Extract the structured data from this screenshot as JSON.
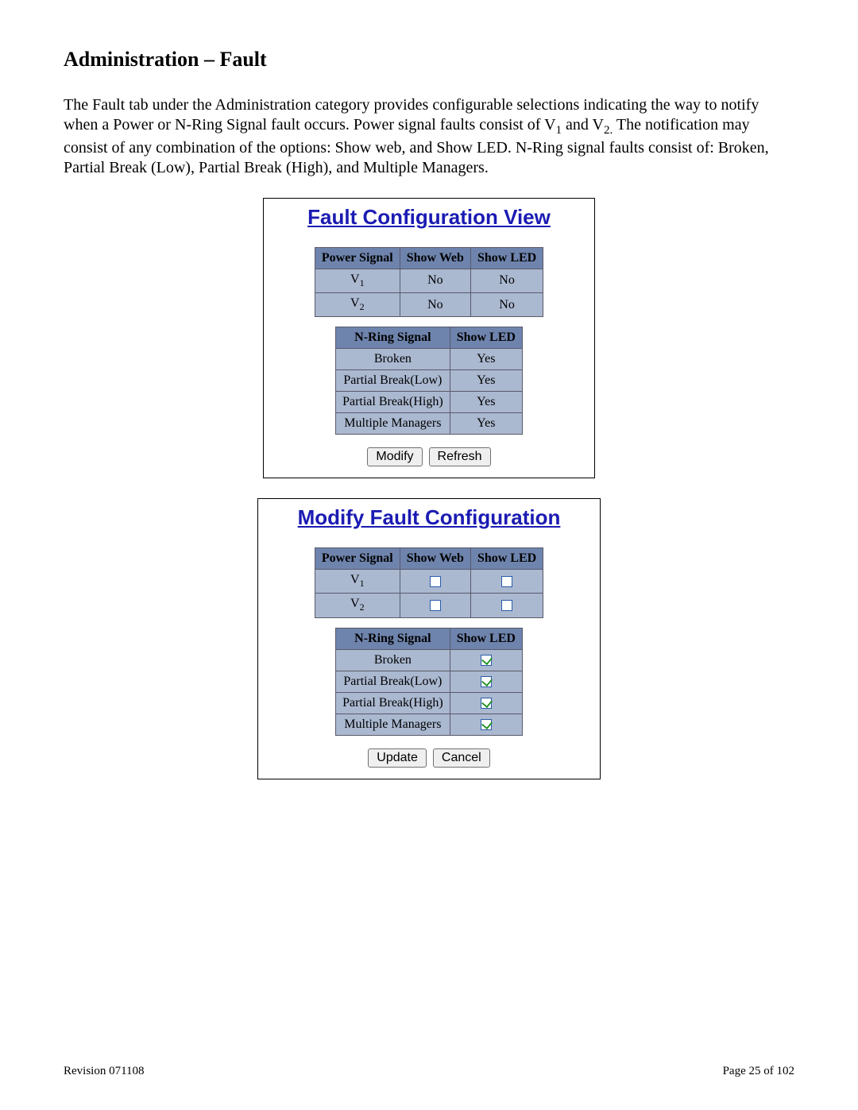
{
  "heading": "Administration – Fault",
  "intro_parts": {
    "p1": "The Fault tab under the Administration category provides configurable selections indicating the way to notify when a Power or N-Ring Signal fault occurs. Power signal faults consist of V",
    "s1": "1",
    "p2": " and V",
    "s2": "2.",
    "p3": "  The notification may consist of any combination of the options: Show web, and Show LED. N-Ring signal faults consist of: Broken, Partial Break (Low), Partial Break (High), and Multiple Managers."
  },
  "view_panel": {
    "title": "Fault Configuration View",
    "power_table": {
      "headers": [
        "Power Signal",
        "Show Web",
        "Show LED"
      ],
      "rows": [
        {
          "label": "V",
          "sub": "1",
          "web": "No",
          "led": "No"
        },
        {
          "label": "V",
          "sub": "2",
          "web": "No",
          "led": "No"
        }
      ]
    },
    "nring_table": {
      "headers": [
        "N-Ring Signal",
        "Show LED"
      ],
      "rows": [
        {
          "label": "Broken",
          "led": "Yes"
        },
        {
          "label": "Partial Break(Low)",
          "led": "Yes"
        },
        {
          "label": "Partial Break(High)",
          "led": "Yes"
        },
        {
          "label": "Multiple Managers",
          "led": "Yes"
        }
      ]
    },
    "buttons": {
      "modify": "Modify",
      "refresh": "Refresh"
    }
  },
  "modify_panel": {
    "title": "Modify Fault Configuration",
    "power_table": {
      "headers": [
        "Power Signal",
        "Show Web",
        "Show LED"
      ],
      "rows": [
        {
          "label": "V",
          "sub": "1",
          "web_checked": false,
          "led_checked": false
        },
        {
          "label": "V",
          "sub": "2",
          "web_checked": false,
          "led_checked": false
        }
      ]
    },
    "nring_table": {
      "headers": [
        "N-Ring Signal",
        "Show LED"
      ],
      "rows": [
        {
          "label": "Broken",
          "led_checked": true
        },
        {
          "label": "Partial Break(Low)",
          "led_checked": true
        },
        {
          "label": "Partial Break(High)",
          "led_checked": true
        },
        {
          "label": "Multiple Managers",
          "led_checked": true
        }
      ]
    },
    "buttons": {
      "update": "Update",
      "cancel": "Cancel"
    }
  },
  "footer": {
    "revision": "Revision 071108",
    "page": "Page 25 of 102"
  }
}
